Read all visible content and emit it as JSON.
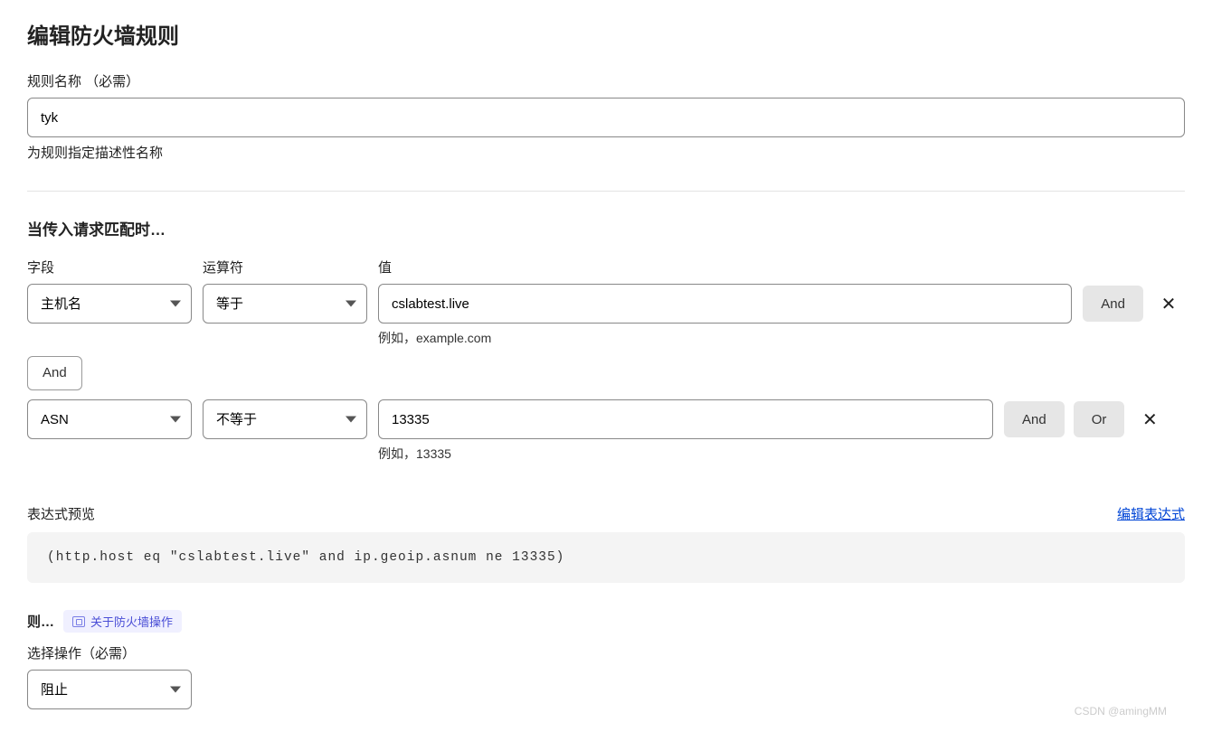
{
  "title": "编辑防火墙规则",
  "ruleName": {
    "label": "规则名称  （必需）",
    "value": "tyk",
    "hint": "为规则指定描述性名称"
  },
  "match": {
    "heading": "当传入请求匹配时…",
    "cols": {
      "field": "字段",
      "operator": "运算符",
      "value": "值"
    },
    "rows": [
      {
        "field": "主机名",
        "operator": "等于",
        "value": "cslabtest.live",
        "hint": "例如，example.com",
        "actions": [
          "And"
        ]
      },
      {
        "field": "ASN",
        "operator": "不等于",
        "value": "13335",
        "hint": "例如，13335",
        "actions": [
          "And",
          "Or"
        ]
      }
    ],
    "connectors": [
      "And"
    ]
  },
  "preview": {
    "label": "表达式预览",
    "editLink": "编辑表达式",
    "expression": "(http.host eq \"cslabtest.live\" and ip.geoip.asnum ne 13335)"
  },
  "then": {
    "label": "则…",
    "helpText": "关于防火墙操作",
    "selectLabel": "选择操作（必需）",
    "action": "阻止"
  },
  "watermark": "CSDN @amingMM"
}
